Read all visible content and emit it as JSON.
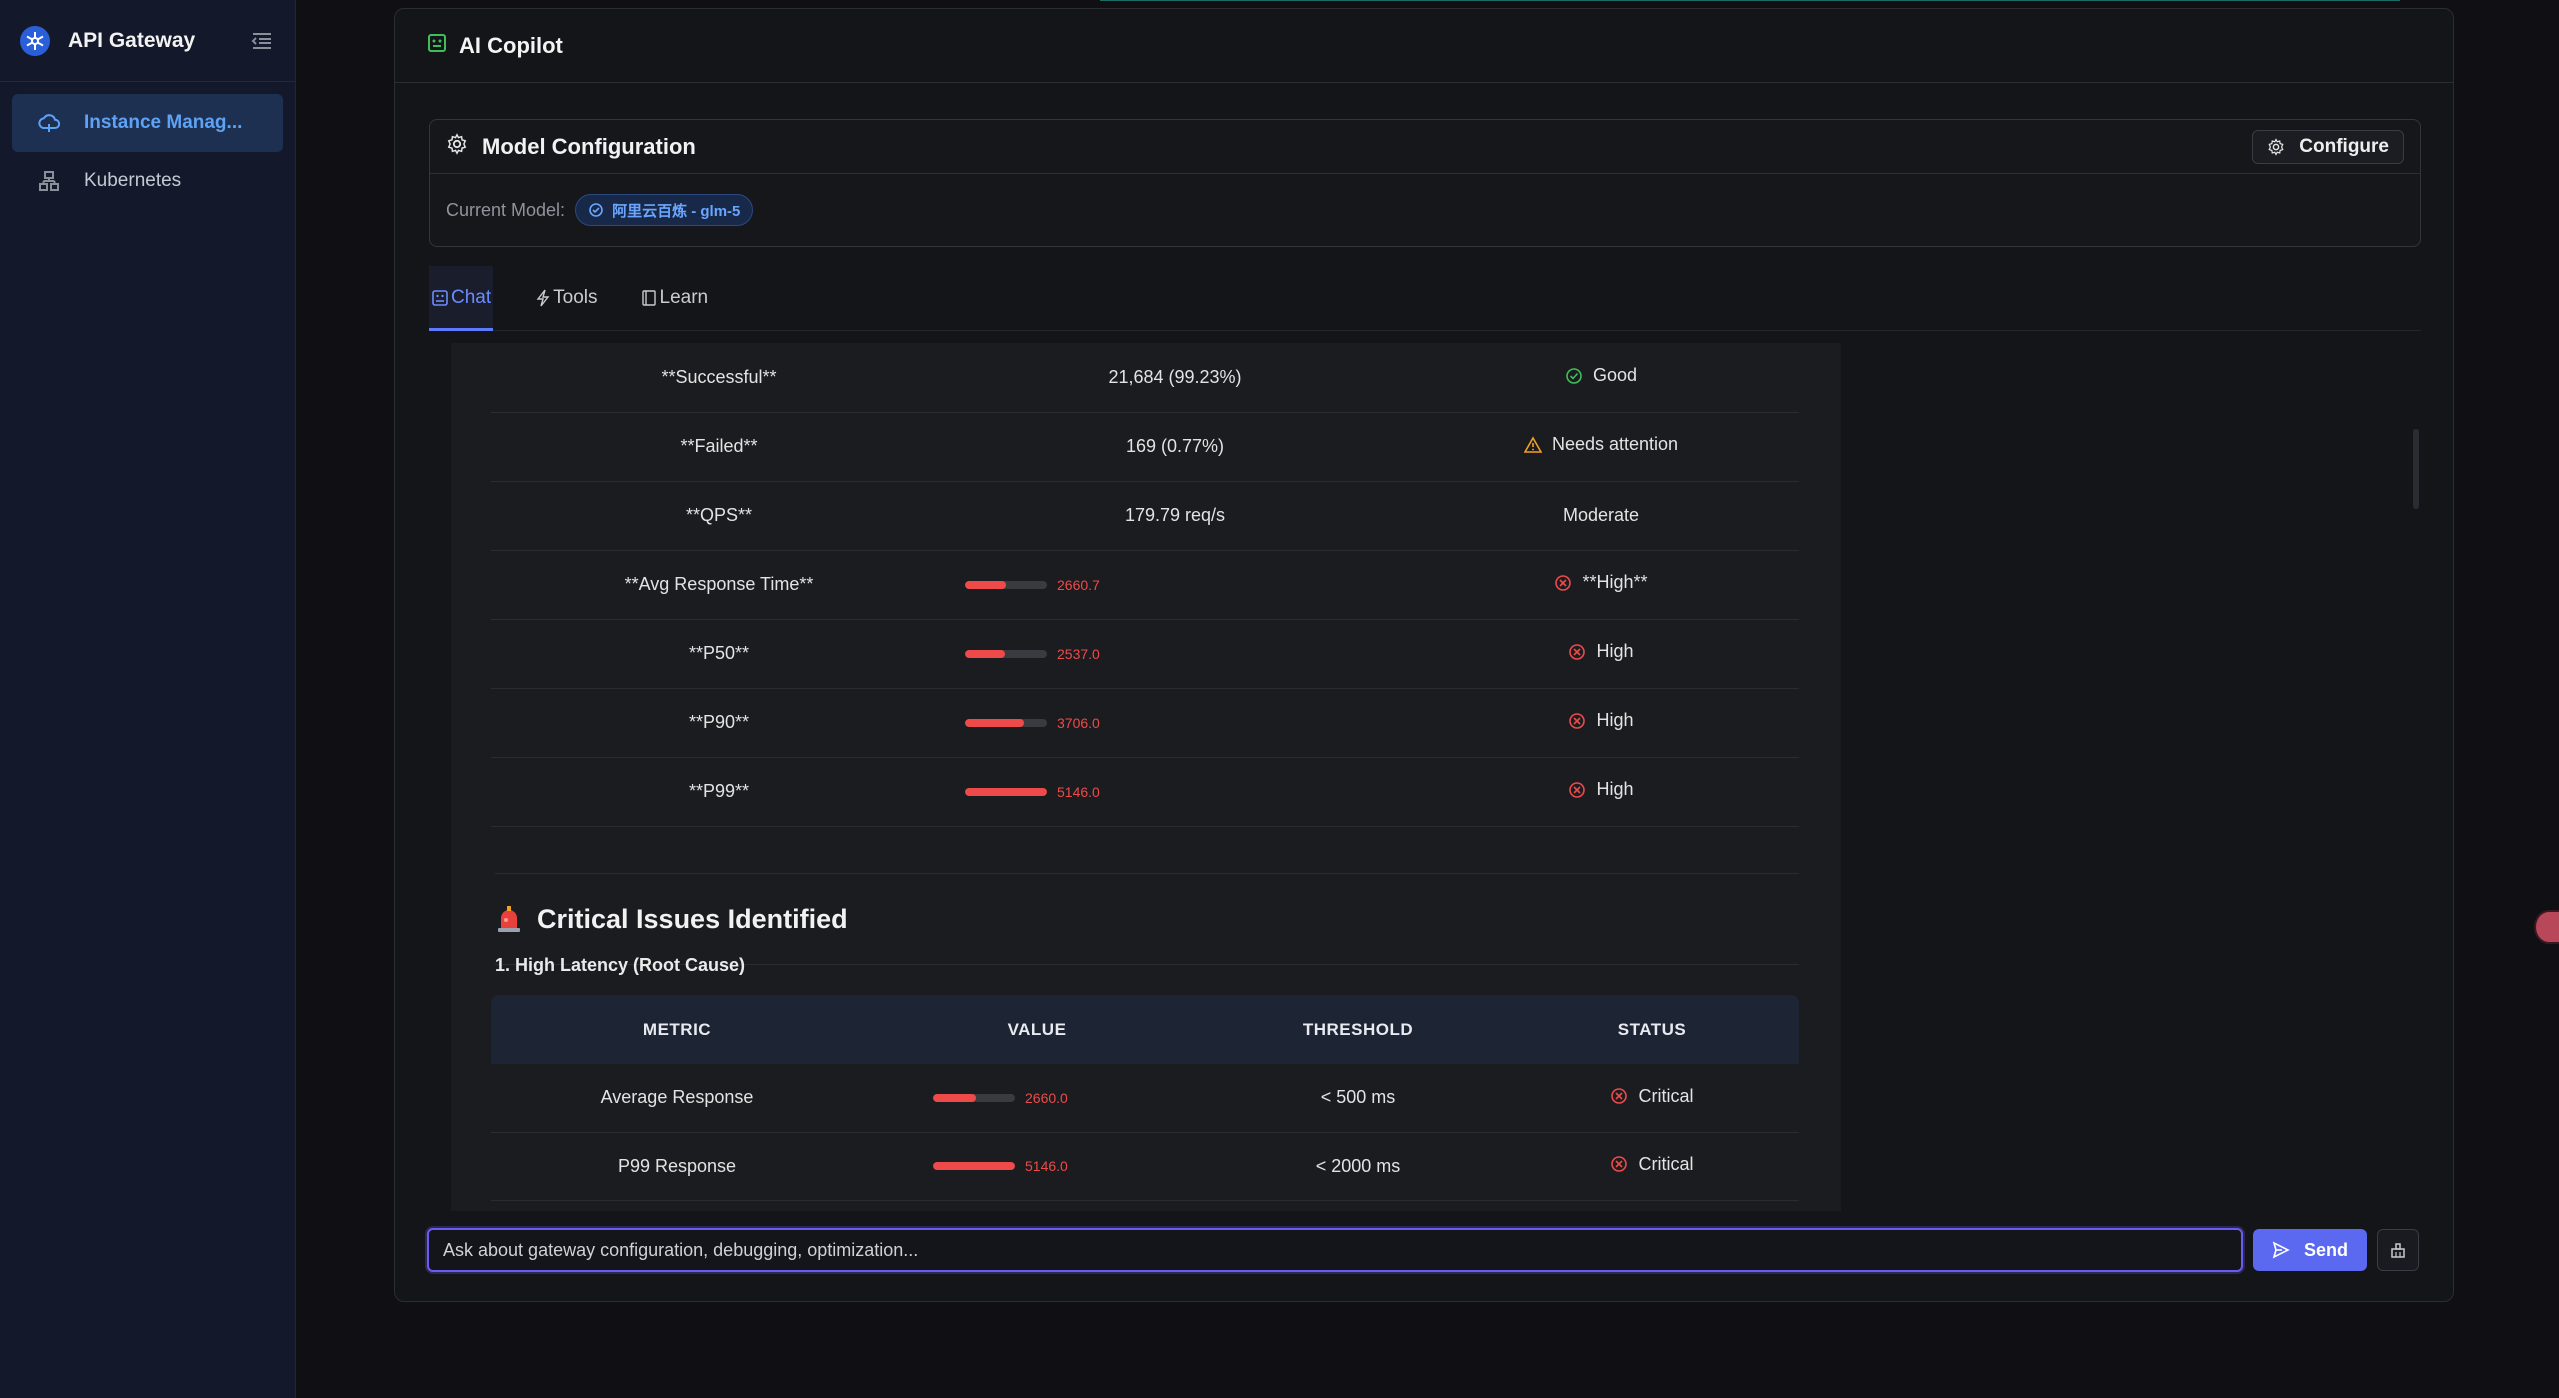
{
  "sidebar": {
    "app_title": "API Gateway",
    "items": [
      {
        "label": "Instance Manag...",
        "icon": "cloud-icon",
        "active": true
      },
      {
        "label": "Kubernetes",
        "icon": "cluster-icon",
        "active": false
      }
    ]
  },
  "panel": {
    "title": "AI Copilot",
    "model_config": {
      "title": "Model Configuration",
      "configure_label": "Configure",
      "current_model_label": "Current Model:",
      "current_model_value": "阿里云百炼 - glm-5"
    },
    "tabs": [
      {
        "label": "Chat",
        "active": true
      },
      {
        "label": "Tools",
        "active": false
      },
      {
        "label": "Learn",
        "active": false
      }
    ]
  },
  "summary_table": {
    "rows": [
      {
        "metric": "**Successful**",
        "value": "21,684 (99.23%)",
        "status": "Good",
        "status_icon": "check-circle-icon",
        "status_color": "#3fbf5a"
      },
      {
        "metric": "**Failed**",
        "value": "169 (0.77%)",
        "status": "Needs attention",
        "status_icon": "warning-icon",
        "status_color": "#f2a122"
      },
      {
        "metric": "**QPS**",
        "value": "179.79 req/s",
        "status": "Moderate",
        "status_icon": "",
        "status_color": ""
      },
      {
        "metric": "**Avg Response Time**",
        "bar_value": "2660.7",
        "bar_fraction": 0.5,
        "status": "**High**",
        "status_icon": "x-circle-icon",
        "status_color": "#ef4a4a"
      },
      {
        "metric": "**P50**",
        "bar_value": "2537.0",
        "bar_fraction": 0.49,
        "status": "High",
        "status_icon": "x-circle-icon",
        "status_color": "#ef4a4a"
      },
      {
        "metric": "**P90**",
        "bar_value": "3706.0",
        "bar_fraction": 0.72,
        "status": "High",
        "status_icon": "x-circle-icon",
        "status_color": "#ef4a4a"
      },
      {
        "metric": "**P99**",
        "bar_value": "5146.0",
        "bar_fraction": 1.0,
        "status": "High",
        "status_icon": "x-circle-icon",
        "status_color": "#ef4a4a"
      }
    ]
  },
  "critical": {
    "title": "Critical Issues Identified",
    "subtitle": "1. High Latency (Root Cause)",
    "headers": [
      "METRIC",
      "VALUE",
      "THRESHOLD",
      "STATUS"
    ],
    "rows": [
      {
        "metric": "Average Response",
        "bar_value": "2660.0",
        "bar_fraction": 0.52,
        "threshold": "< 500 ms",
        "status": "Critical"
      },
      {
        "metric": "P99 Response",
        "bar_value": "5146.0",
        "bar_fraction": 1.0,
        "threshold": "< 2000 ms",
        "status": "Critical"
      }
    ]
  },
  "input": {
    "placeholder": "Ask about gateway configuration, debugging, optimization...",
    "send_label": "Send"
  },
  "colors": {
    "accent": "#5b68f0",
    "danger": "#ef4a4a",
    "success": "#3fbf5a",
    "warning": "#f2a122",
    "link": "#5ea2f5"
  }
}
